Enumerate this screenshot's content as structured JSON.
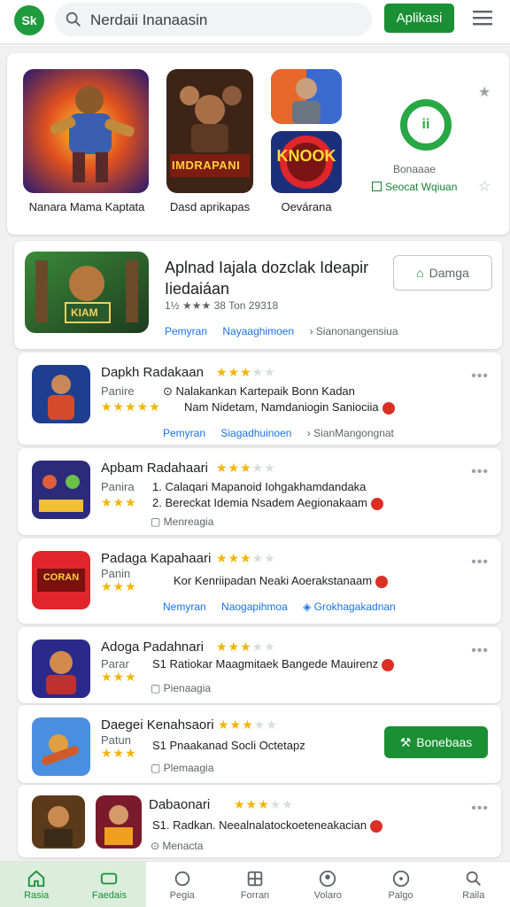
{
  "header": {
    "logo_text": "Sk",
    "search_value": "Nerdaii Inanaasin",
    "apply_label": "Aplikasi"
  },
  "featured": {
    "items": [
      {
        "label": "Nanara Mama Kaptata",
        "icon": "warrior-game-art"
      },
      {
        "label": "Dasd aprikapas",
        "icon": "heroes-game-art"
      },
      {
        "label": "Oevárana",
        "icon": "knock-game-art"
      }
    ],
    "knock_text": "KNOOK",
    "hero_text": "IMDRAPANI",
    "badge_text": "ii",
    "side_label": "Bonaaae",
    "side_link": "Seocat Wqiuan"
  },
  "promo": {
    "title": "Aplnad Iajala dozclak Ideapir Iiedaiáan",
    "rating_line": "1½ ★★★ 38 Ton 29318",
    "button_label": "Damga",
    "links": [
      "Pemyran",
      "Nayaaghimoen",
      "Sianonangensiua"
    ],
    "art_text": "KIAM"
  },
  "rows": [
    {
      "title": "Dapkh Radakaan",
      "rating": 3.5,
      "sub": "Panire",
      "desc1": "Nalakankan Kartepaik Bonn Kadan",
      "desc2": "Nam Nidetam, Namdaniogin Saniociia",
      "links": [
        "Pemyran",
        "Siagadhuinoen",
        "SianMangongnat"
      ],
      "meta": ""
    },
    {
      "title": "Apbam Radahaari",
      "rating": 3.5,
      "sub": "Panira",
      "desc1": "Calaqari Mapanoid Iohgakhamdandaka",
      "desc2": "Bereckat Idemia Nsadem Aegionakaam",
      "links": [],
      "meta": "Menreagia"
    },
    {
      "title": "Padaga Kapahaari",
      "rating": 3.5,
      "sub": "Panin",
      "desc1": "Kor Kenriipadan Neaki Aoerakstanaam",
      "desc2": "",
      "links": [
        "Nemyran",
        "Naogapihmoa",
        "Grokhagakadnan"
      ],
      "meta": ""
    },
    {
      "title": "Adoga Padahnari",
      "rating": 3.5,
      "sub": "Parar",
      "desc1": "Ratiokar Maagmitaek Bangede Mauirenz",
      "desc2": "",
      "links": [],
      "meta": "Pienaagia"
    },
    {
      "title": "Daegei Kenahsaori",
      "rating": 3.5,
      "sub": "Patun",
      "desc1": "Pnaakanad Socli Octetapz",
      "desc2": "",
      "links": [],
      "meta": "Plemaagia",
      "install_label": "Bonebaas"
    },
    {
      "title": "Dabaonari",
      "rating": 3.5,
      "sub": "",
      "desc1": "Radkan. Neealnalatockoeteneakacian",
      "desc2": "",
      "links": [],
      "meta": "Menacta"
    }
  ],
  "bottom_nav": [
    {
      "label": "Rasia",
      "icon": "home-icon"
    },
    {
      "label": "Faedais",
      "icon": "games-icon"
    },
    {
      "label": "Pegia",
      "icon": "apps-icon"
    },
    {
      "label": "Forran",
      "icon": "grid-icon"
    },
    {
      "label": "Volaro",
      "icon": "profile-icon"
    },
    {
      "label": "Palgo",
      "icon": "circle-icon"
    },
    {
      "label": "Raila",
      "icon": "search-icon"
    }
  ],
  "colors": {
    "brand_green": "#1a8f34",
    "star_gold": "#f4b400",
    "link_blue": "#1a73e8"
  }
}
